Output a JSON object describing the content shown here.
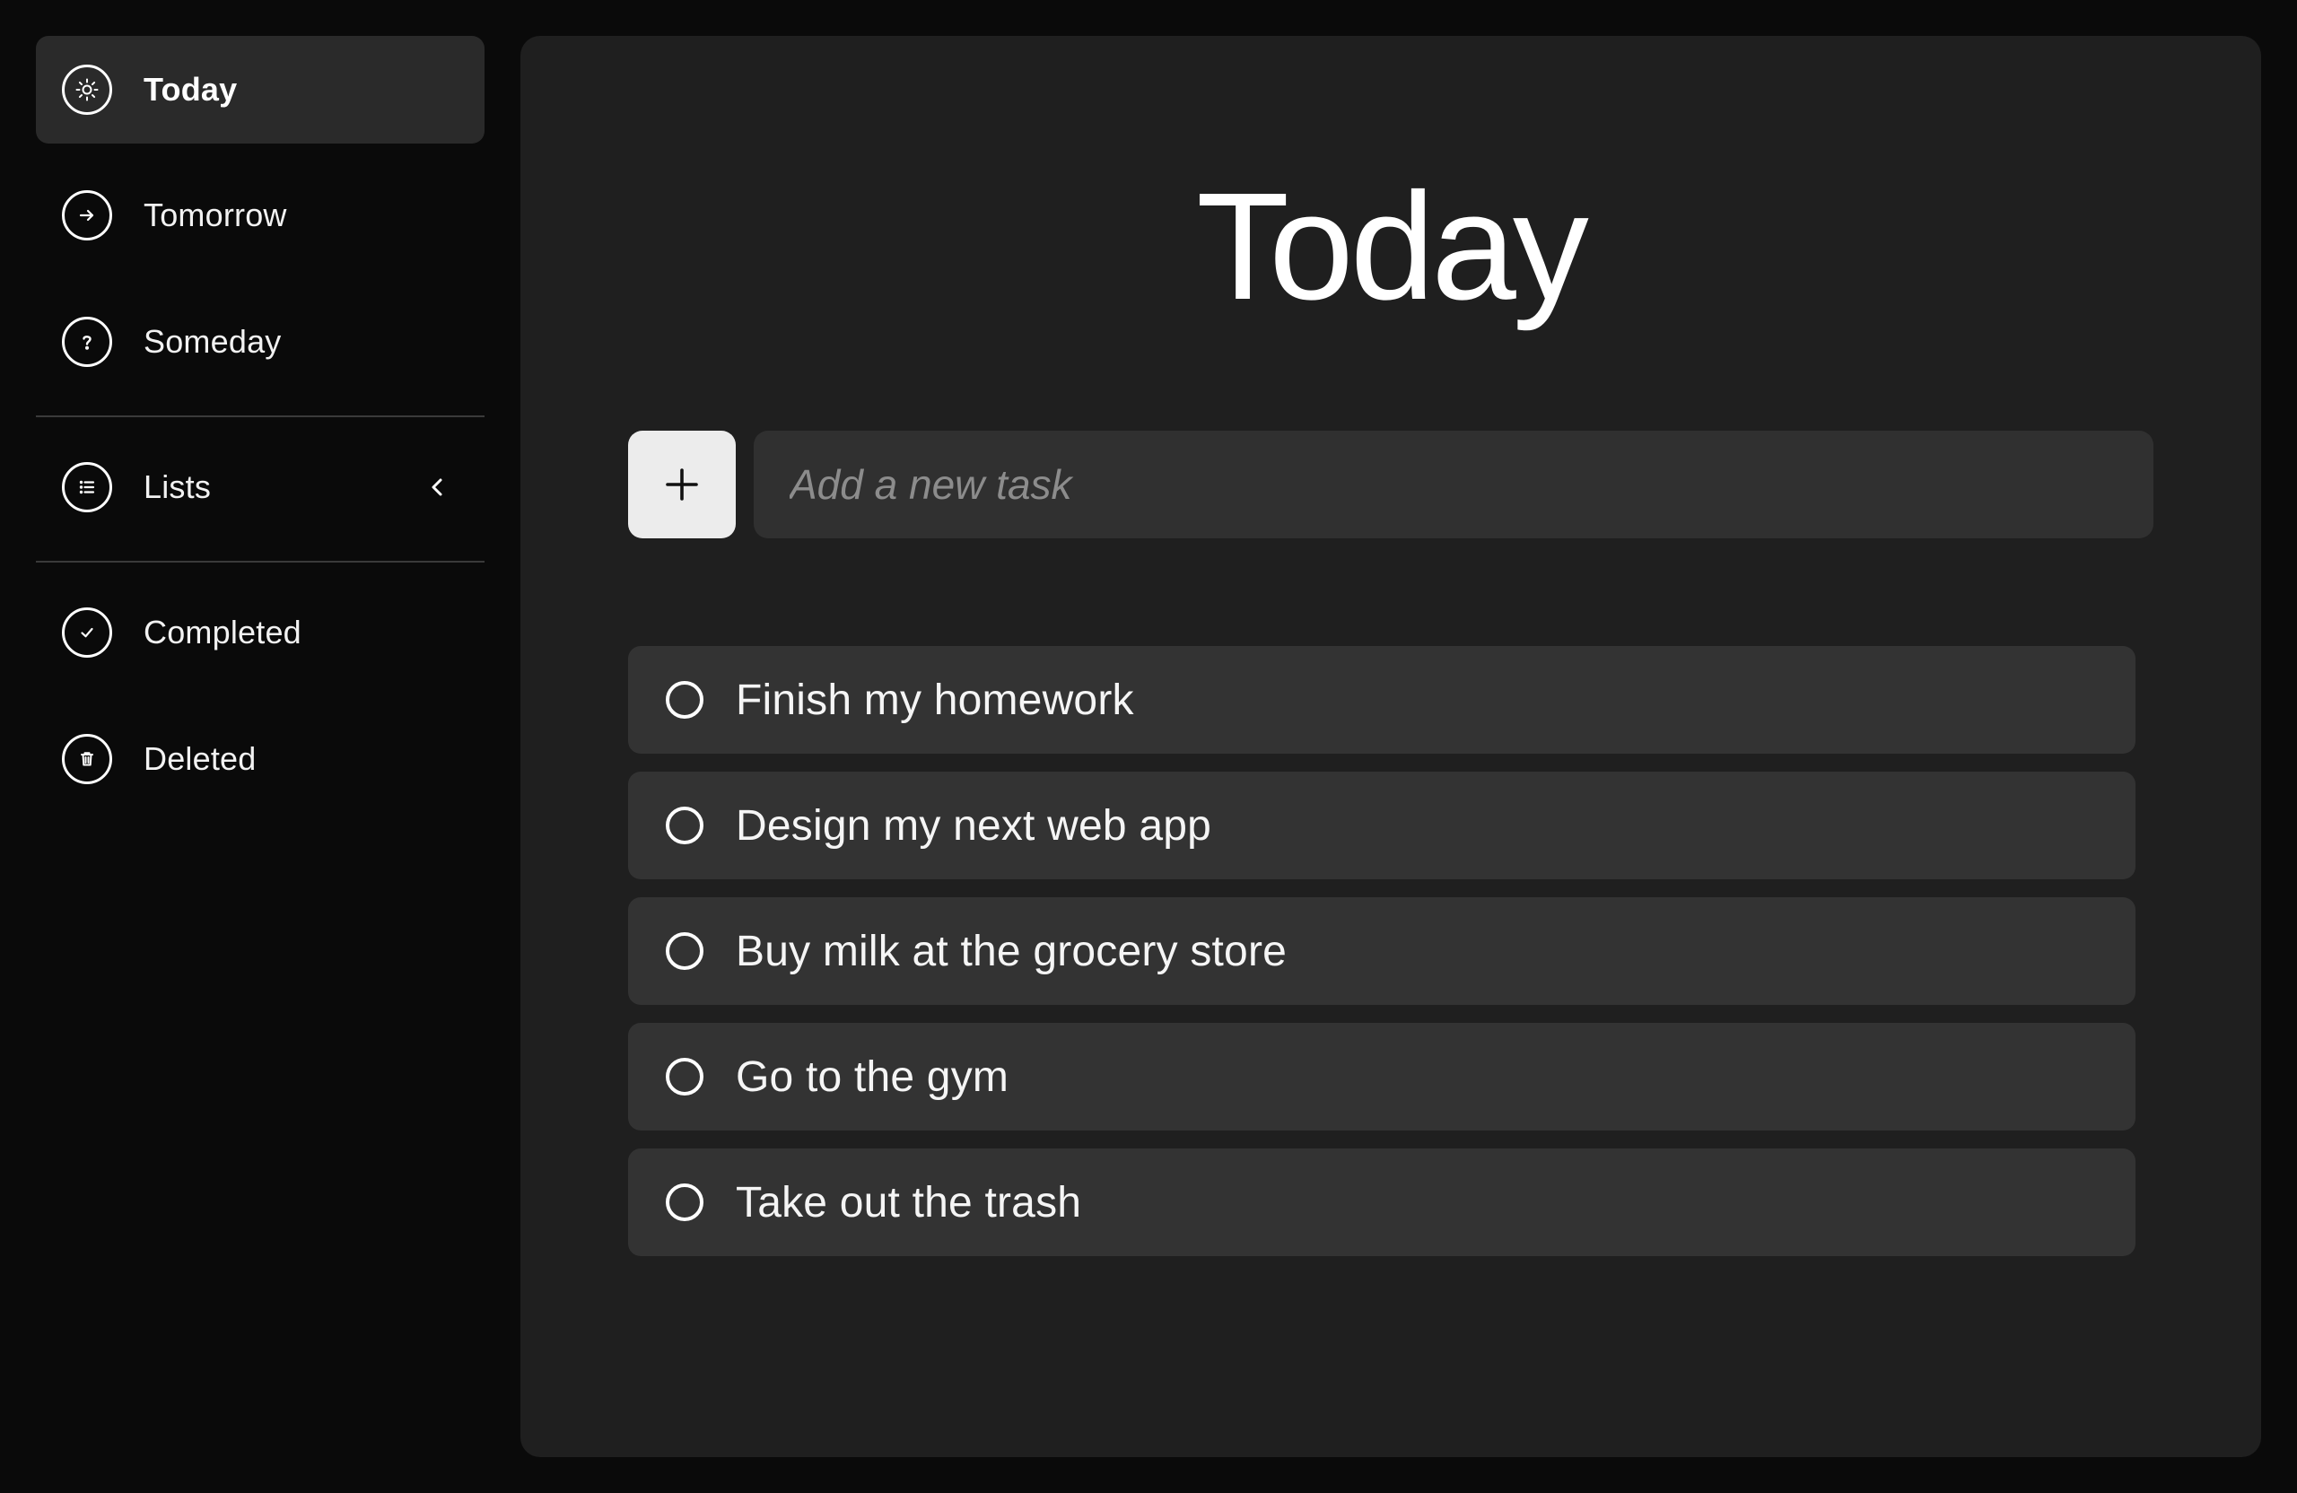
{
  "sidebar": {
    "items": [
      {
        "label": "Today",
        "icon": "sun-icon",
        "active": true
      },
      {
        "label": "Tomorrow",
        "icon": "arrow-right-icon",
        "active": false
      },
      {
        "label": "Someday",
        "icon": "question-icon",
        "active": false
      },
      {
        "label": "Lists",
        "icon": "list-icon",
        "active": false,
        "expand_icon": "chevron-left-icon"
      },
      {
        "label": "Completed",
        "icon": "check-icon",
        "active": false
      },
      {
        "label": "Deleted",
        "icon": "trash-icon",
        "active": false
      }
    ]
  },
  "main": {
    "title": "Today",
    "add_button_icon": "plus-icon",
    "new_task_placeholder": "Add a new task",
    "tasks": [
      {
        "text": "Finish my homework",
        "completed": false
      },
      {
        "text": "Design my next web app",
        "completed": false
      },
      {
        "text": "Buy milk at the grocery store",
        "completed": false
      },
      {
        "text": "Go to the gym",
        "completed": false
      },
      {
        "text": "Take out the trash",
        "completed": false
      }
    ]
  },
  "colors": {
    "background": "#0a0a0a",
    "panel": "#1f1f1f",
    "active_item": "#2a2a2a",
    "task_row": "#333333",
    "input": "#303030",
    "add_button": "#ececec",
    "divider": "#3a3a3a",
    "text": "#ffffff",
    "placeholder": "#8c8c8c"
  }
}
